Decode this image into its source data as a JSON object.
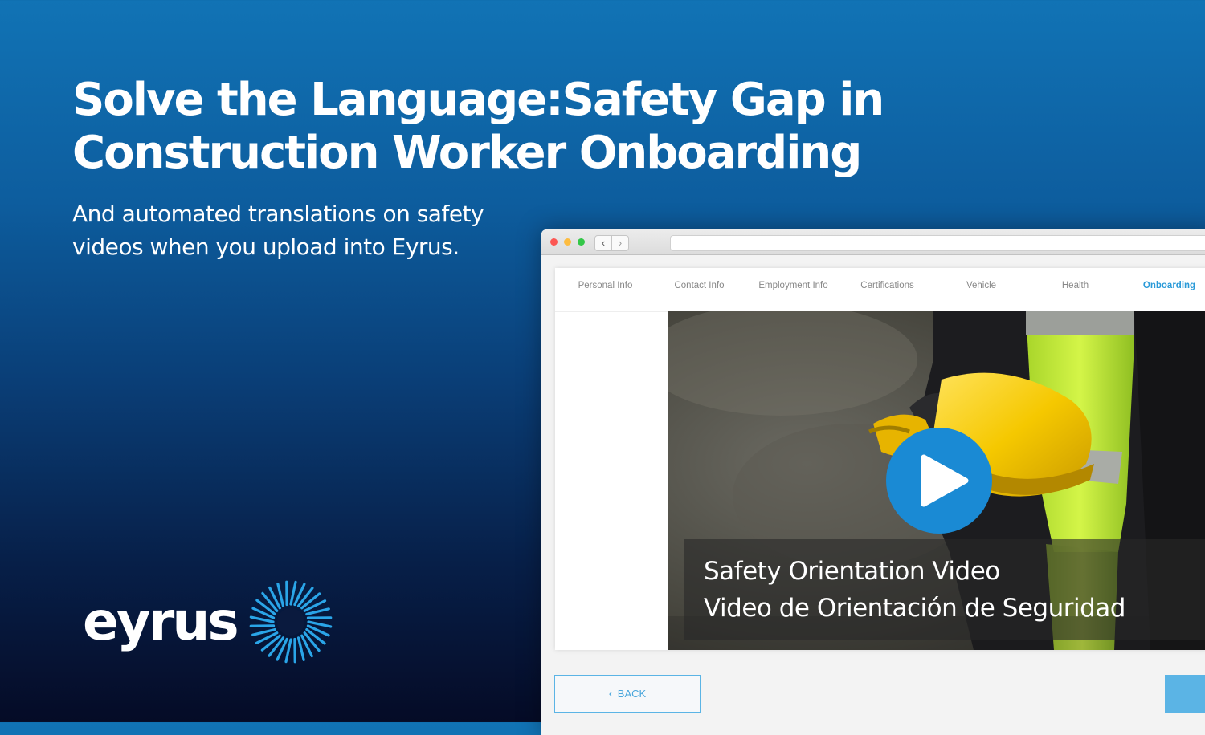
{
  "hero": {
    "title_line1": "Solve the Language:Safety Gap in",
    "title_line2": "Construction Worker Onboarding",
    "subtitle_line1": "And automated translations on safety",
    "subtitle_line2": "videos when you upload into Eyrus."
  },
  "logo": {
    "wordmark": "eyrus",
    "icon": "sunburst-icon"
  },
  "browser": {
    "nav_back_glyph": "‹",
    "nav_forward_glyph": "›",
    "tabs": [
      {
        "label": "Personal Info"
      },
      {
        "label": "Contact Info"
      },
      {
        "label": "Employment Info"
      },
      {
        "label": "Certifications"
      },
      {
        "label": "Vehicle"
      },
      {
        "label": "Health"
      },
      {
        "label": "Onboarding",
        "active": true
      }
    ],
    "video": {
      "caption_en": "Safety Orientation Video",
      "caption_es": "Video de Orientación de Seguridad",
      "play_icon": "play-icon"
    },
    "back_label": "BACK",
    "back_icon": "chevron-left-icon"
  },
  "colors": {
    "accent": "#2a9ad8",
    "play_button": "#1a8ad4",
    "vest": "#c8f040",
    "hard_hat": "#f5c800"
  }
}
